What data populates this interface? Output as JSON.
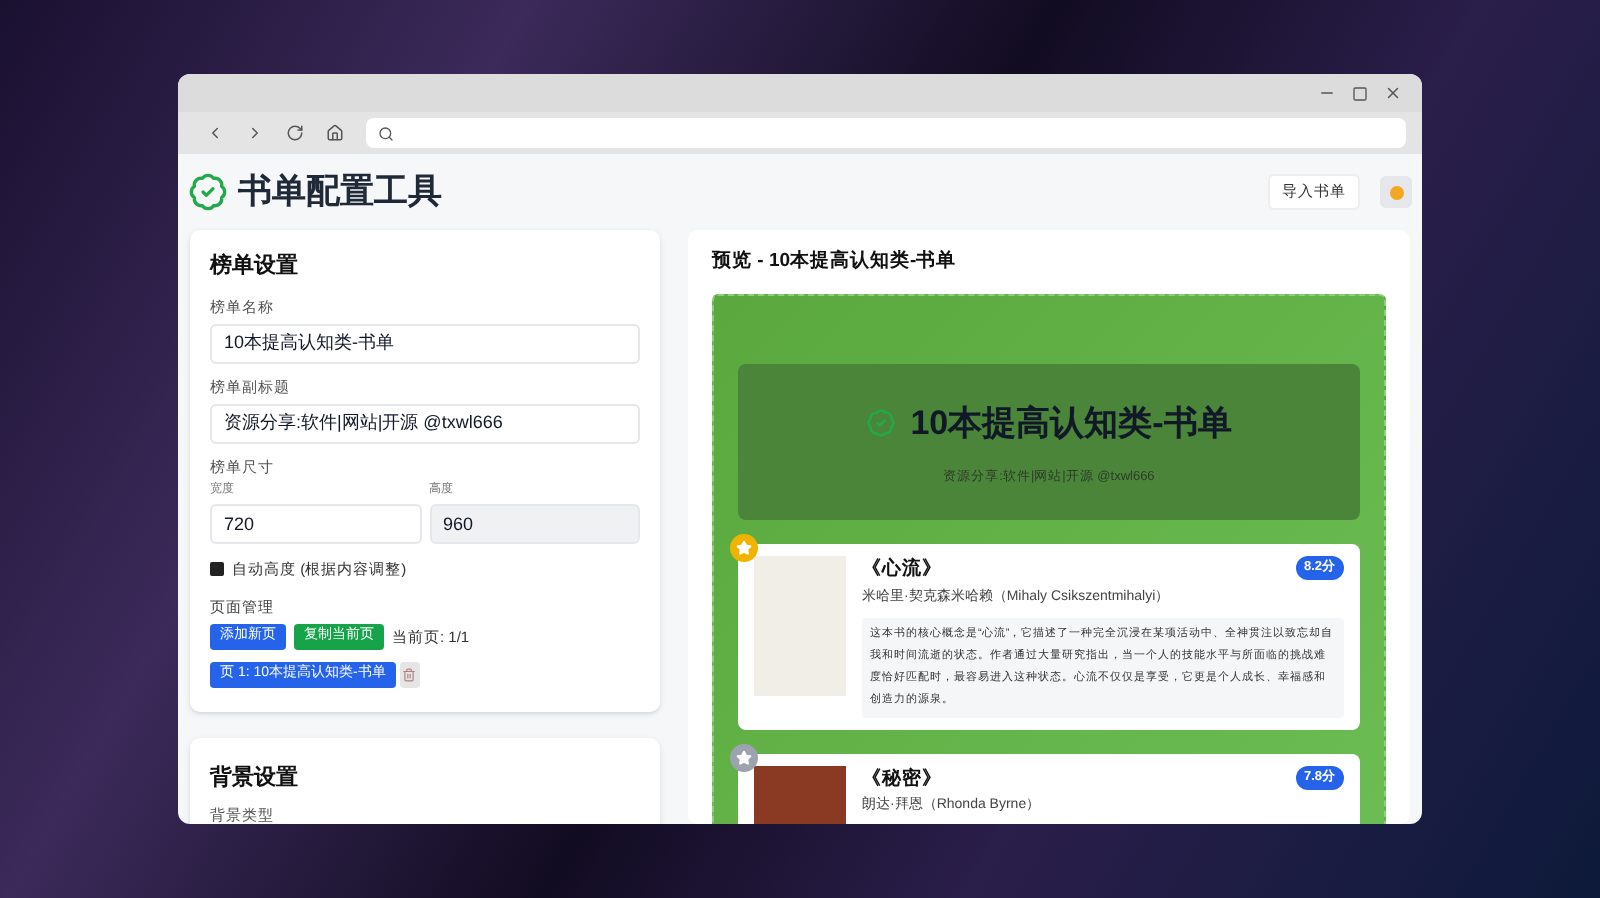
{
  "app": {
    "title": "书单配置工具",
    "import_button": "导入书单"
  },
  "list_settings": {
    "heading": "榜单设置",
    "name_field": {
      "label": "榜单名称",
      "value": "10本提高认知类-书单"
    },
    "subtitle_field": {
      "label": "榜单副标题",
      "value": "资源分享:软件|网站|开源 @txwl666"
    },
    "size": {
      "label": "榜单尺寸",
      "width_label": "宽度",
      "width_value": "720",
      "height_label": "高度",
      "height_value": "960",
      "height_disabled": true
    },
    "auto_height": {
      "label": "自动高度 (根据内容调整)",
      "checked": true
    },
    "pages": {
      "label": "页面管理",
      "add_button": "添加新页",
      "copy_button": "复制当前页",
      "current": "当前页: 1/1",
      "items": [
        {
          "label": "页 1: 10本提高认知类-书单",
          "selected": true
        }
      ]
    }
  },
  "background_settings": {
    "heading": "背景设置",
    "field_label": "背景类型"
  },
  "preview": {
    "heading": "预览 - 10本提高认知类-书单",
    "title": "10本提高认知类-书单",
    "subtitle": "资源分享:软件|网站|开源 @txwl666",
    "books": [
      {
        "title": "《心流》",
        "author": "米哈里·契克森米哈赖（Mihaly Csikszentmihalyi）",
        "score": "8.2分",
        "color": "#f0b400",
        "description": "这本书的核心概念是“心流”，它描述了一种完全沉浸在某项活动中、全神贯注以致忘却自我和时间流逝的状态。作者通过大量研究指出，当一个人的技能水平与所面临的挑战难度恰好匹配时，最容易进入这种状态。心流不仅仅是享受，它更是个人成长、幸福感和创造力的源泉。"
      },
      {
        "title": "《秘密》",
        "author": "朗达·拜恩（Rhonda Byrne）",
        "score": "7.8分",
        "color": "#9ca3af"
      }
    ]
  }
}
